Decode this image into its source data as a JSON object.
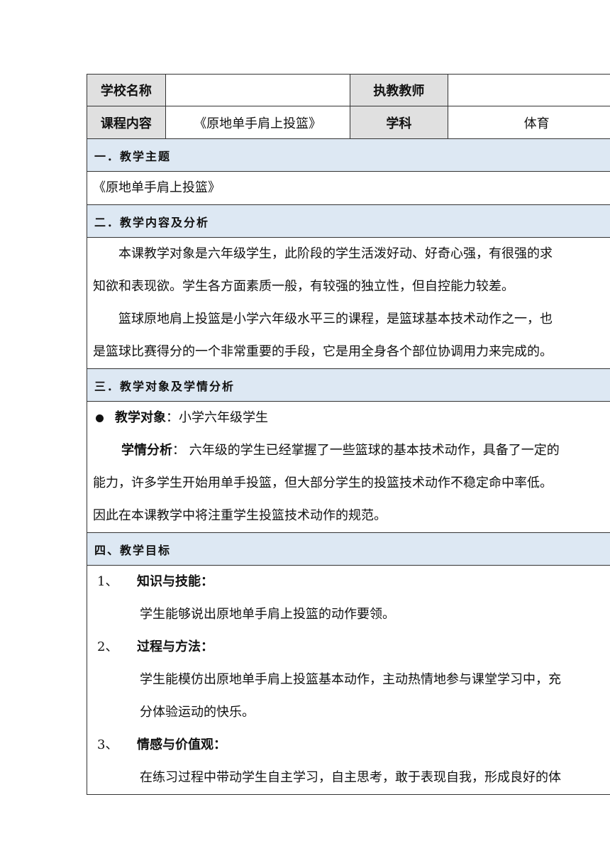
{
  "header": {
    "school_label": "学校名称",
    "school_value": "",
    "teacher_label": "执教教师",
    "teacher_value": "",
    "course_label": "课程内容",
    "course_value": "《原地单手肩上投篮》",
    "subject_label": "学科",
    "subject_value": "体育"
  },
  "sections": {
    "s1": {
      "title": "一．教学主题",
      "text": "《原地单手肩上投篮》"
    },
    "s2": {
      "title": "二．教学内容及分析",
      "p1_line1": "本课教学对象是六年级学生，此阶段的学生活泼好动、好奇心强，有很强的求",
      "p1_line2": "知欲和表现欲。学生各方面素质一般，有较强的独立性，但自控能力较差。",
      "p2_line1": "篮球原地肩上投篮是小学六年级水平三的课程，是篮球基本技术动作之一，也",
      "p2_line2": "是篮球比赛得分的一个非常重要的手段，它是用全身各个部位协调用力来完成的。"
    },
    "s3": {
      "title": "三．教学对象及学情分析",
      "object_label": "教学对象",
      "object_text": "：小学六年级学生",
      "analysis_label": "学情分析",
      "analysis_line1": "： 六年级的学生已经掌握了一些篮球的基本技术动作，具备了一定的",
      "analysis_line2": "能力，许多学生开始用单手投篮，但大部分学生的投篮技术动作不稳定命中率低。",
      "analysis_line3": "因此在本课教学中将注重学生投篮技术动作的规范。"
    },
    "s4": {
      "title": "四、教学目标",
      "goals": [
        {
          "num": "1、",
          "head": "知识与技能：",
          "line1": "学生能够说出原地单手肩上投篮的动作要领。",
          "line2": ""
        },
        {
          "num": "2、",
          "head": "过程与方法：",
          "line1": "学生能模仿出原地单手肩上投篮基本动作，主动热情地参与课堂学习中，充",
          "line2": "分体验运动的快乐。"
        },
        {
          "num": "3、",
          "head": "情感与价值观：",
          "line1": "在练习过程中带动学生自主学习，自主思考，敢于表现自我，形成良好的体",
          "line2": ""
        }
      ]
    }
  }
}
